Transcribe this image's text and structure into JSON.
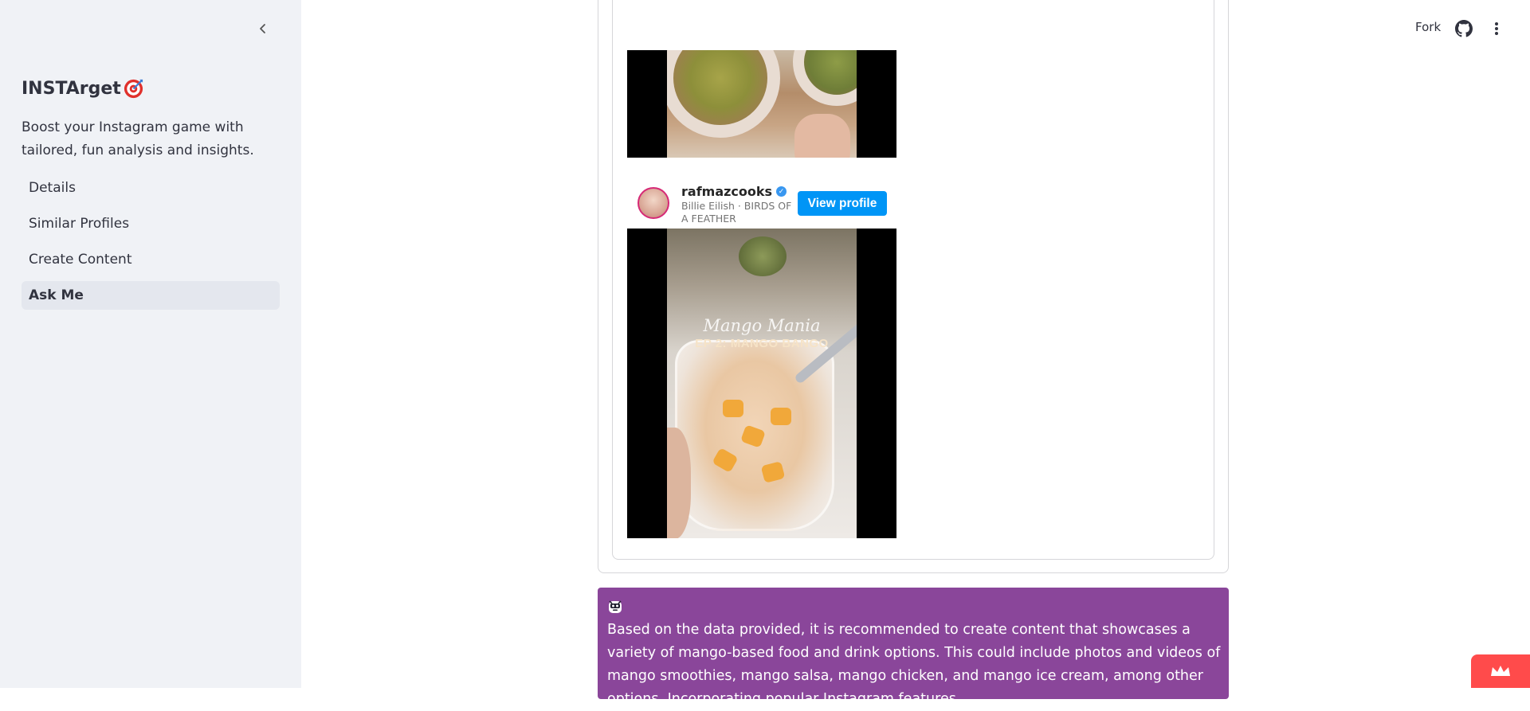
{
  "sidebar": {
    "title": "INSTArget",
    "tagline": "Boost your Instagram game with tailored, fun analysis and insights.",
    "nav": [
      {
        "label": "Details"
      },
      {
        "label": "Similar Profiles"
      },
      {
        "label": "Create Content"
      },
      {
        "label": "Ask Me"
      }
    ],
    "active_index": 3
  },
  "header": {
    "fork_label": "Fork"
  },
  "embed": {
    "username": "rafmazcooks",
    "verified": true,
    "music": "Billie Eilish · BIRDS OF A FEATHER",
    "view_profile_label": "View profile",
    "video_overlay_script": "Mango Mania",
    "video_overlay_title": "EP 2: MANGO BANGO"
  },
  "assistant": {
    "text": "Based on the data provided, it is recommended to create content that showcases a variety of mango-based food and drink options. This could include photos and videos of mango smoothies, mango salsa, mango chicken, and mango ice cream, among other options. Incorporating popular Instagram features"
  },
  "colors": {
    "sidebar_bg": "#f0f2f6",
    "assistant_bg": "#8a469a",
    "button_blue": "#0095f6",
    "badge_red": "#ff4b4b"
  },
  "icons": {
    "collapse": "chevron-left-icon",
    "title_emoji": "target-icon",
    "github": "github-icon",
    "menu": "kebab-menu-icon",
    "assistant": "bot-avatar-icon",
    "badge": "crown-icon"
  }
}
